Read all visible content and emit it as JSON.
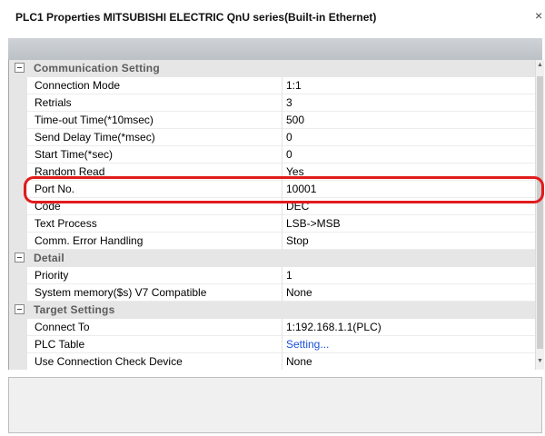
{
  "window": {
    "title": "PLC1 Properties MITSUBISHI ELECTRIC QnU series(Built-in Ethernet)",
    "close_glyph": "×"
  },
  "icons": {
    "collapse": "minus-box-icon",
    "close": "close-icon"
  },
  "colors": {
    "highlight": "#e11b1b",
    "link": "#1a4fd6",
    "category_bg": "#e6e6e6"
  },
  "grid": {
    "categories": [
      {
        "label": "Communication Setting",
        "properties": [
          {
            "name": "Connection Mode",
            "value": "1:1"
          },
          {
            "name": "Retrials",
            "value": "3"
          },
          {
            "name": "Time-out Time(*10msec)",
            "value": "500"
          },
          {
            "name": "Send Delay Time(*msec)",
            "value": "0"
          },
          {
            "name": "Start Time(*sec)",
            "value": "0"
          },
          {
            "name": "Random Read",
            "value": "Yes"
          },
          {
            "name": "Port No.",
            "value": "10001",
            "highlighted": true
          },
          {
            "name": "Code",
            "value": "DEC"
          },
          {
            "name": "Text Process",
            "value": "LSB->MSB"
          },
          {
            "name": "Comm. Error Handling",
            "value": "Stop"
          }
        ]
      },
      {
        "label": "Detail",
        "properties": [
          {
            "name": "Priority",
            "value": "1"
          },
          {
            "name": "System memory($s) V7 Compatible",
            "value": "None"
          }
        ]
      },
      {
        "label": "Target Settings",
        "properties": [
          {
            "name": "Connect To",
            "value": "1:192.168.1.1(PLC)"
          },
          {
            "name": "PLC Table",
            "value": "Setting...",
            "link": true
          },
          {
            "name": "Use Connection Check Device",
            "value": "None"
          }
        ]
      }
    ]
  }
}
